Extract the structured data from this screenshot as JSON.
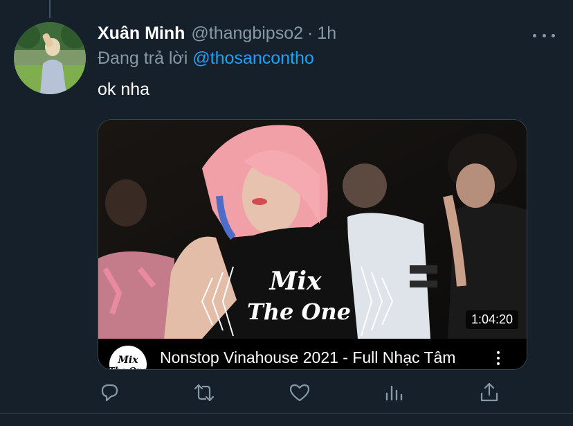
{
  "tweet": {
    "display_name": "Xuân Minh",
    "handle": "@thangbipso2",
    "separator": "·",
    "time": "1h",
    "reply_prefix": "Đang trả lời",
    "reply_to": "@thosancontho",
    "text": "ok nha"
  },
  "card": {
    "duration": "1:04:20",
    "video_title": "Nonstop Vinahouse 2021 - Full Nhạc Tâm",
    "logo_text_1": "Mix",
    "logo_text_2": "The One"
  },
  "actions": [
    "reply-icon",
    "retweet-icon",
    "like-icon",
    "analytics-icon",
    "share-icon"
  ],
  "colors": {
    "background": "#15202b",
    "secondary_text": "#8899a6",
    "mention": "#1da1f2",
    "divider": "#38444d"
  }
}
